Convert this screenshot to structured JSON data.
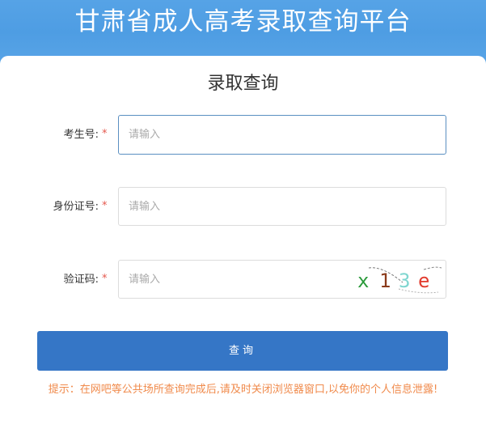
{
  "header": {
    "title": "甘肃省成人高考录取查询平台"
  },
  "form": {
    "title": "录取查询",
    "required_mark": "*",
    "fields": [
      {
        "label": "考生号:",
        "placeholder": "请输入",
        "value": ""
      },
      {
        "label": "身份证号:",
        "placeholder": "请输入",
        "value": ""
      },
      {
        "label": "验证码:",
        "placeholder": "请输入",
        "value": ""
      }
    ],
    "captcha": {
      "chars": [
        "x",
        "1",
        "3",
        "e"
      ],
      "colors": [
        "#2a9a3a",
        "#8a3a1a",
        "#7fd6d0",
        "#e23b2e"
      ]
    },
    "submit_label": "查询",
    "notice": "提示：在网吧等公共场所查询完成后,请及时关闭浏览器窗口,以免你的个人信息泄露!"
  },
  "colors": {
    "header_bg": "#56a3e6",
    "button_bg": "#3576c6",
    "required": "#e5584d",
    "notice": "#f08a4b"
  }
}
